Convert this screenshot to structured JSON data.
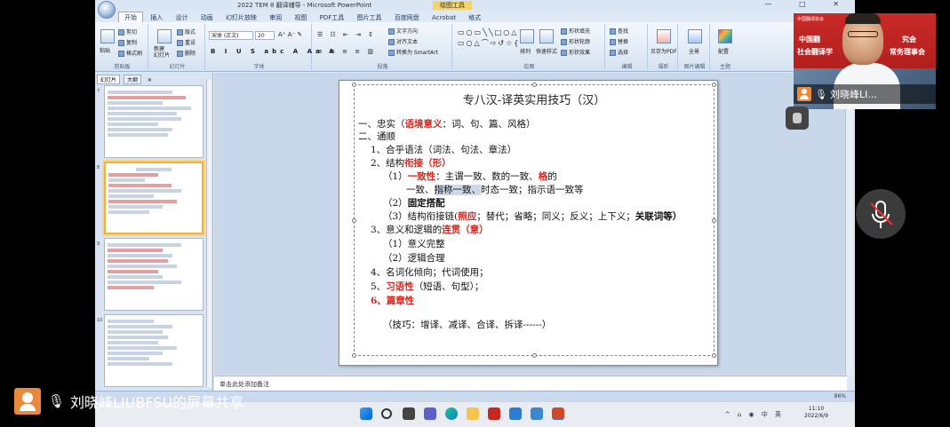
{
  "ppt": {
    "window_title": "2022 TEM 8 翻译辅导 - Microsoft PowerPoint",
    "context_tab": "绘图工具",
    "window_buttons": "— □ ✕",
    "tabs": [
      "开始",
      "插入",
      "设计",
      "动画",
      "幻灯片放映",
      "审阅",
      "视图",
      "PDF工具",
      "图片工具",
      "百度网盘",
      "Acrobat",
      "格式"
    ],
    "ribbon": {
      "clipboard": {
        "paste": "粘贴",
        "cut": "剪切",
        "copy": "复制",
        "format_painter": "格式刷",
        "label": "剪贴板"
      },
      "slides": {
        "new_slide": "新建\n幻灯片",
        "layout": "版式",
        "reset": "重设",
        "delete": "删除",
        "label": "幻灯片"
      },
      "font": {
        "name": "宋体 (正文)",
        "size": "20",
        "label": "字体"
      },
      "paragraph": {
        "text_direction": "文字方向",
        "align_text": "对齐文本",
        "smartart": "转换为 SmartArt",
        "label": "段落"
      },
      "drawing": {
        "arrange": "排列",
        "quick_styles": "快速样式",
        "fill": "形状填充",
        "outline": "形状轮廓",
        "effects": "形状效果",
        "label": "绘图"
      },
      "editing": {
        "find": "查找",
        "replace": "替换",
        "select": "选择",
        "label": "编辑"
      },
      "pdf": {
        "label": "另存为PDF",
        "group": "福昕"
      },
      "panorama": {
        "label": "全景",
        "group": "图片编辑"
      },
      "theme": {
        "label": "配置",
        "group": "主题"
      }
    },
    "left_pane_tabs": [
      "幻灯片",
      "大纲"
    ],
    "thumbnails": [
      {
        "num": "7"
      },
      {
        "num": "8"
      },
      {
        "num": "9"
      },
      {
        "num": "10"
      }
    ],
    "slide": {
      "title": "专八汉-译英实用技巧（汉）",
      "l1": "一、忠实（",
      "l1_red": "语境意义",
      "l1_rest": "：词、句、篇、风格）",
      "l2": "二、通顺",
      "l3": "1、合乎语法（词法、句法、章法）",
      "l4": "2、结构",
      "l4_red": "衔接（形）",
      "l5_pre": "（1）",
      "l5_red": "一致性",
      "l5_rest": "：主谓一致、数的一致、",
      "l5_red2": "格",
      "l5_end": "的",
      "l6_pre": "一致、",
      "l6_hl": "指称一致、",
      "l6_rest": "时态一致；指示语一致等",
      "l7": "（2）",
      "l7_b": "固定搭配",
      "l8_pre": "（3）结构衔接链(",
      "l8_red": "照应",
      "l8_rest": "；替代；省略；同义；反义；上下义；",
      "l8_b": "关联词等）",
      "l9_pre": "3、意义和逻辑的",
      "l9_red": "连贯（意）",
      "l10": "（1）意义完整",
      "l11": "（2）逻辑合理",
      "l12": "4、名词化倾向；代词使用；",
      "l13_pre": "5、",
      "l13_red": "习语性",
      "l13_rest": "（短语、句型）；",
      "l14_red": "6、篇章性",
      "l15": "（技巧：增译、减译、合译、拆译------）"
    },
    "notes_placeholder": "单击此处添加备注",
    "status_zoom": "86%"
  },
  "taskbar": {
    "time": "11:10",
    "date": "2022/6/9",
    "tray": "^ ⌂ ◉ 中 英"
  },
  "meeting": {
    "share_label": "刘晓峰LIUBFSU的屏幕共享",
    "video_name": "刘晓峰LI...",
    "banner_left": "中国翻",
    "banner_right": "究会",
    "banner_line2": "社会翻译学",
    "banner_line2_right": "常务理事会",
    "banner_small": "中国翻译协会"
  },
  "colors": {
    "accent_red": "#d8241c",
    "avatar_orange": "#e8893b",
    "ribbon_bg": "#dfe9f5"
  }
}
